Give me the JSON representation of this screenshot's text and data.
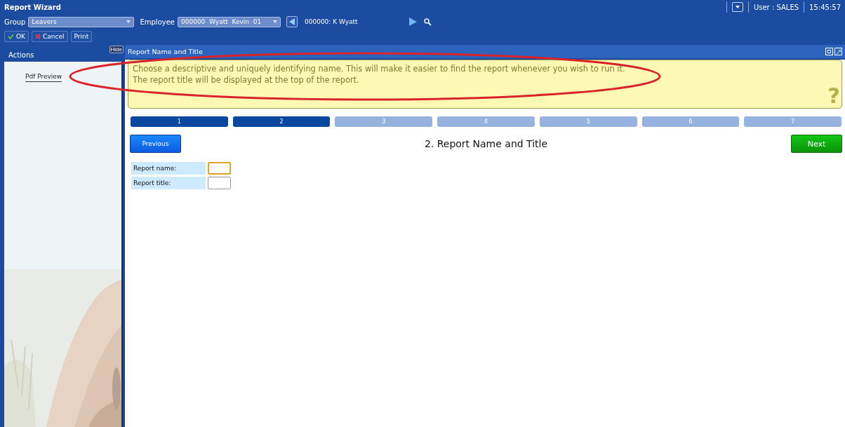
{
  "window": {
    "title": "Report Wizard"
  },
  "header": {
    "user": "User : SALES",
    "time": "15:45:57"
  },
  "filters": {
    "group_label": "Group",
    "group_value": "Leavers",
    "employee_label": "Employee",
    "employee_value": "000000  Wyatt  Kevin  01",
    "employee_name": "000000: K Wyatt"
  },
  "buttons": [
    {
      "label": "OK",
      "kind": "ok"
    },
    {
      "label": "Cancel",
      "kind": "cancel"
    },
    {
      "label": "Print",
      "kind": "plain"
    }
  ],
  "sidebar": {
    "title": "Actions",
    "hide_label": "Hide",
    "items": [
      {
        "label": "Pdf Preview"
      }
    ]
  },
  "panel": {
    "title": "Report Name and Title",
    "help": [
      "Choose a descriptive and uniquely identifying name. This will make it easier to find the report whenever you wish to run it.",
      "The report title will be displayed at the top of the report."
    ],
    "help_icon": "?",
    "steps": [
      {
        "label": "1",
        "reached": true
      },
      {
        "label": "2",
        "reached": true
      },
      {
        "label": "3",
        "reached": false
      },
      {
        "label": "4",
        "reached": false
      },
      {
        "label": "5",
        "reached": false
      },
      {
        "label": "6",
        "reached": false
      },
      {
        "label": "7",
        "reached": false
      }
    ],
    "previous": "Previous",
    "heading": "2. Report Name and Title",
    "next": "Next",
    "fields": [
      {
        "label": "Report name:",
        "focused": true
      },
      {
        "label": "Report title:",
        "focused": false
      }
    ]
  },
  "annotations": [
    {
      "kind": "ellipse",
      "color": "#d8232a"
    }
  ]
}
